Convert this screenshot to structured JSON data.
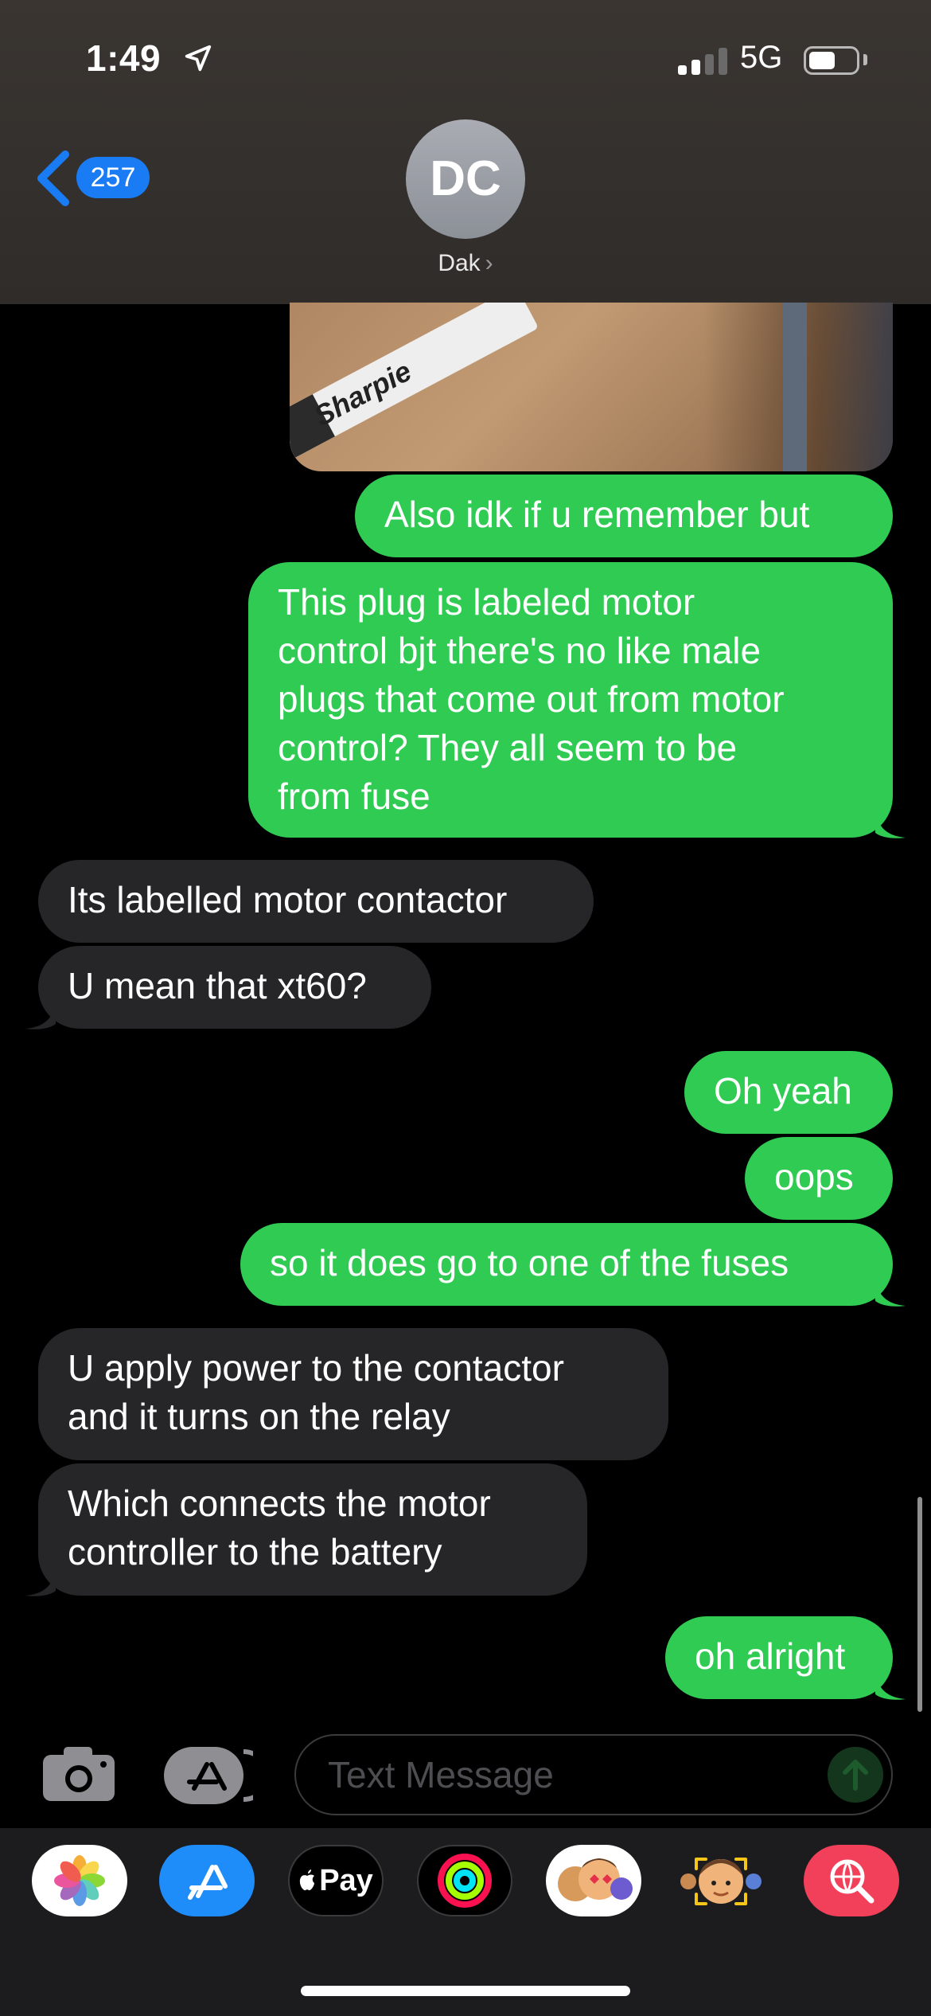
{
  "status_bar": {
    "time": "1:49",
    "network": "5G"
  },
  "header": {
    "back_count": "257",
    "avatar_initials": "DC",
    "contact_name": "Dak",
    "contact_chevron": "›"
  },
  "photo": {
    "marker_text": "Sharpie"
  },
  "messages": [
    {
      "from": "me",
      "text": "Also idk if u remember but"
    },
    {
      "from": "me",
      "text": "This plug is labeled motor\ncontrol bjt there's no like male\nplugs that come out from motor\ncontrol? They all seem to be\nfrom fuse"
    },
    {
      "from": "them",
      "text": "Its labelled motor contactor"
    },
    {
      "from": "them",
      "text": "U mean that xt60?"
    },
    {
      "from": "me",
      "text": "Oh yeah"
    },
    {
      "from": "me",
      "text": "oops"
    },
    {
      "from": "me",
      "text": "so it does go to one of the fuses"
    },
    {
      "from": "them",
      "text": "U apply power to the contactor\nand it turns on the relay"
    },
    {
      "from": "them",
      "text": "Which connects the motor\ncontroller to the battery"
    },
    {
      "from": "me",
      "text": "oh alright"
    }
  ],
  "composer": {
    "placeholder": "Text Message"
  },
  "app_drawer": [
    {
      "name": "photos-app-icon"
    },
    {
      "name": "app-store-icon"
    },
    {
      "name": "apple-pay-icon",
      "label": "Pay"
    },
    {
      "name": "activity-icon"
    },
    {
      "name": "memoji-stickers-icon"
    },
    {
      "name": "memoji-icon"
    },
    {
      "name": "image-search-icon"
    }
  ],
  "colors": {
    "sent_bubble": "#2fcb53",
    "received_bubble": "#262629",
    "accent": "#1a7cf5"
  }
}
